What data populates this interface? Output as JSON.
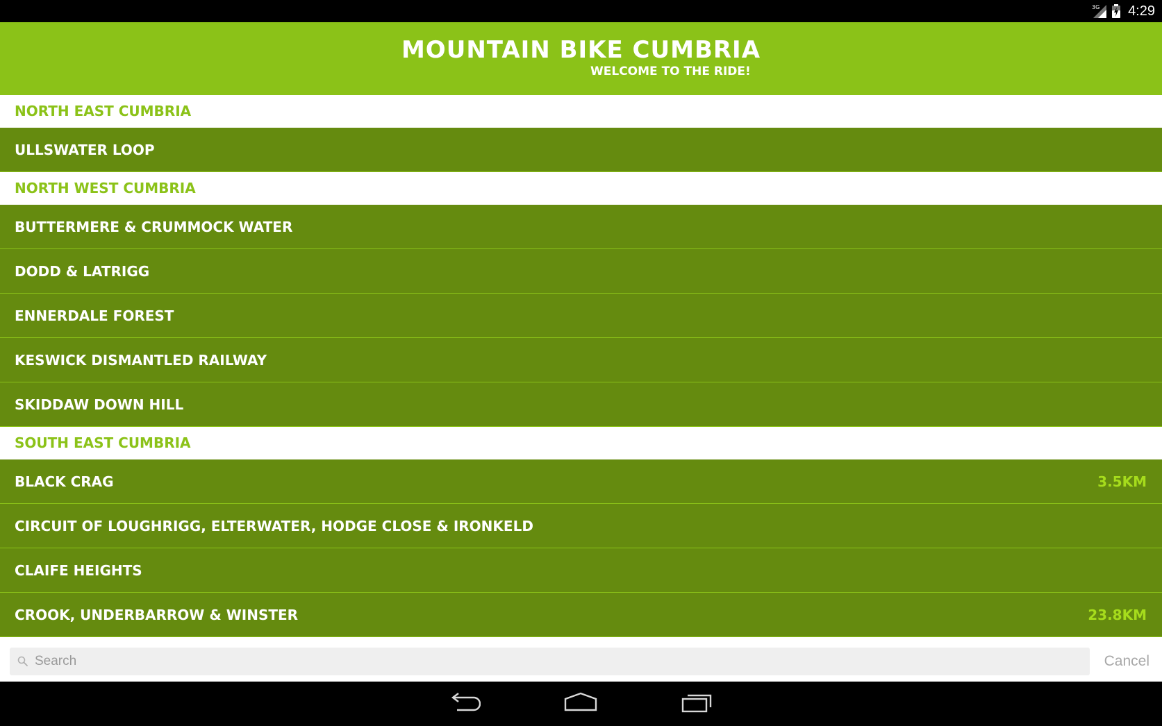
{
  "status_bar": {
    "network": "3G",
    "time": "4:29"
  },
  "header": {
    "title": "MOUNTAIN BIKE CUMBRIA",
    "subtitle": "WELCOME TO THE RIDE!",
    "background_color": "#8bc218"
  },
  "list": {
    "sections": [
      {
        "title": "NORTH EAST CUMBRIA",
        "routes": [
          {
            "name": "ULLSWATER LOOP",
            "distance": ""
          }
        ]
      },
      {
        "title": "NORTH WEST CUMBRIA",
        "routes": [
          {
            "name": "BUTTERMERE & CRUMMOCK WATER",
            "distance": ""
          },
          {
            "name": "DODD & LATRIGG",
            "distance": ""
          },
          {
            "name": "ENNERDALE FOREST",
            "distance": ""
          },
          {
            "name": "KESWICK DISMANTLED RAILWAY",
            "distance": ""
          },
          {
            "name": "SKIDDAW DOWN HILL",
            "distance": ""
          }
        ]
      },
      {
        "title": "SOUTH EAST CUMBRIA",
        "routes": [
          {
            "name": "BLACK CRAG",
            "distance": "3.5KM"
          },
          {
            "name": "CIRCUIT OF LOUGHRIGG, ELTERWATER, HODGE CLOSE & IRONKELD",
            "distance": ""
          },
          {
            "name": "CLAIFE HEIGHTS",
            "distance": ""
          },
          {
            "name": "CROOK, UNDERBARROW & WINSTER",
            "distance": "23.8KM"
          }
        ]
      }
    ],
    "row_color": "#658b0f",
    "distance_color": "#a6dc1c"
  },
  "search": {
    "placeholder": "Search",
    "value": "",
    "cancel_label": "Cancel"
  },
  "nav_bar": {
    "back_icon": "back-icon",
    "home_icon": "home-icon",
    "recents_icon": "recents-icon"
  }
}
